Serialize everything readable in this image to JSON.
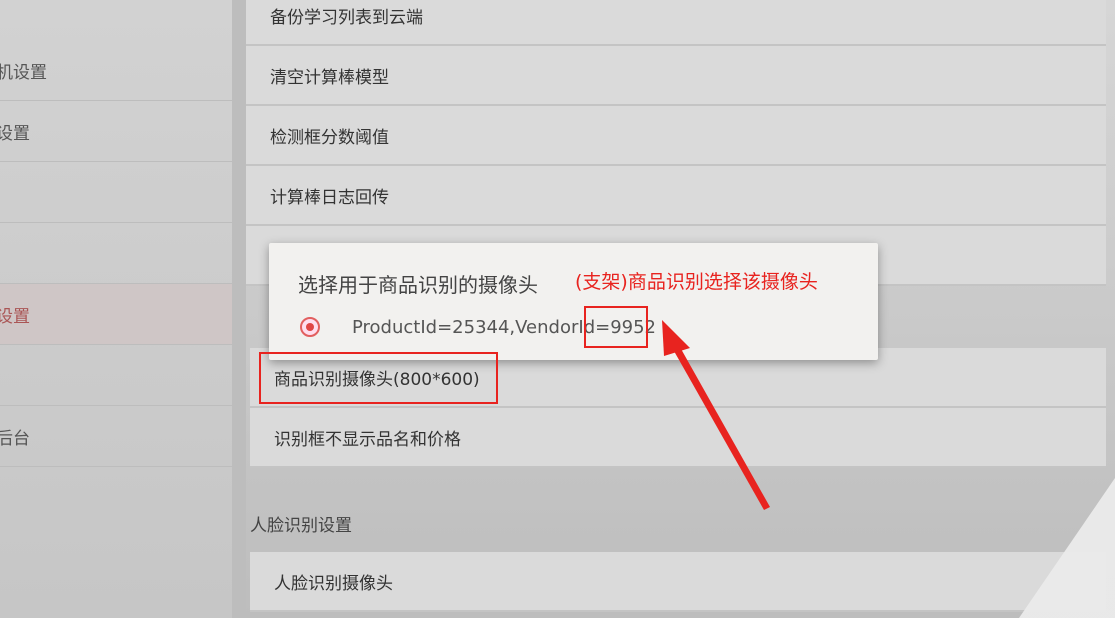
{
  "sidebar": {
    "items": [
      {
        "label": "机设置"
      },
      {
        "label": "设置"
      },
      {
        "label": ""
      },
      {
        "label": ""
      },
      {
        "label": "设置"
      },
      {
        "label": ""
      },
      {
        "label": "后台"
      }
    ]
  },
  "settings": {
    "rows": [
      {
        "label": "备份学习列表到云端"
      },
      {
        "label": "清空计算棒模型"
      },
      {
        "label": "检测框分数阈值"
      },
      {
        "label": "计算棒日志回传"
      },
      {
        "label": ""
      },
      {
        "label": "商品识别摄像头(800*600)"
      },
      {
        "label": "识别框不显示品名和价格"
      }
    ],
    "face_section_header": "人脸识别设置",
    "face_row": {
      "label": "人脸识别摄像头"
    }
  },
  "dialog": {
    "title": "选择用于商品识别的摄像头",
    "option_label": "ProductId=25344,VendorId=9952",
    "option_selected": true
  },
  "annotation": {
    "note": "(支架)商品识别选择该摄像头",
    "color": "#e8231f"
  }
}
